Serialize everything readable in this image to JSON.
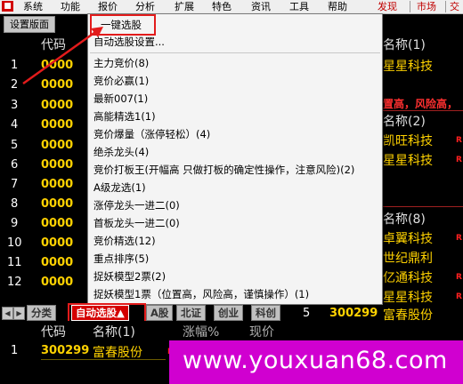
{
  "menubar": {
    "logo": "■",
    "items": [
      "系统",
      "功能",
      "报价",
      "分析",
      "扩展",
      "特色",
      "资讯",
      "工具",
      "帮助"
    ],
    "right": [
      "发现",
      "市场",
      "交易"
    ]
  },
  "toolbar": {
    "tab": "设置版面"
  },
  "grid": {
    "header": {
      "code": "代码",
      "name_right": "名称(1)"
    },
    "rows": [
      {
        "num": "1",
        "code": "0000"
      },
      {
        "num": "2",
        "code": "0000"
      },
      {
        "num": "3",
        "code": "0000"
      },
      {
        "num": "4",
        "code": "0000"
      },
      {
        "num": "5",
        "code": "0000"
      },
      {
        "num": "6",
        "code": "0000"
      },
      {
        "num": "7",
        "code": "0000"
      },
      {
        "num": "8",
        "code": "0000"
      },
      {
        "num": "9",
        "code": "0000"
      },
      {
        "num": "10",
        "code": "0000"
      },
      {
        "num": "11",
        "code": "0000"
      },
      {
        "num": "12",
        "code": "0000"
      }
    ],
    "right_col": {
      "r1": "星星科技",
      "r3_red": "置高，风险高，",
      "hdr2": "名称(2)",
      "r5": "凯旺科技",
      "r6": "星星科技",
      "hdr3": "名称(8)",
      "r10": "卓翼科技",
      "r11": "世纪鼎利",
      "r12": "亿通科技",
      "r13": "星星科技",
      "r_flag": "R"
    }
  },
  "context_menu": {
    "items": [
      "一键选股",
      "自动选股设置...",
      "主力竞价(8)",
      "竞价必赢(1)",
      "最新007(1)",
      "高能精选1(1)",
      "竞价爆量（涨停轻松）(4)",
      "绝杀龙头(4)",
      "竞价打板王(开幅高 只做打板的确定性操作，注意风险)(2)",
      "A级龙选(1)",
      "涨停龙头一进二(0)",
      "首板龙头一进二(0)",
      "竞价精选(12)",
      "重点排序(5)",
      "捉妖模型2票(2)",
      "捉妖模型1票（位置高，风险高，谨慎操作）(1)"
    ]
  },
  "bottom_tabs": {
    "tabs": [
      "分类",
      "自动选股▲",
      "A股",
      "北证",
      "创业",
      "科创"
    ],
    "active_index": 1,
    "right_row": {
      "num": "5",
      "code": "300299",
      "name": "富春股份"
    }
  },
  "lower_panel": {
    "header": {
      "code": "代码",
      "name": "名称(1)",
      "extra1": "涨幅%",
      "extra2": "现价"
    },
    "row": {
      "num": "1",
      "code": "300299",
      "name": "富春股份",
      "flag": "R"
    }
  },
  "watermark": {
    "text": "www.youxuan68.com"
  },
  "colors": {
    "accent_red": "#e21b1b",
    "stock_yellow": "#ffd200",
    "watermark_magenta": "#d000d0"
  }
}
